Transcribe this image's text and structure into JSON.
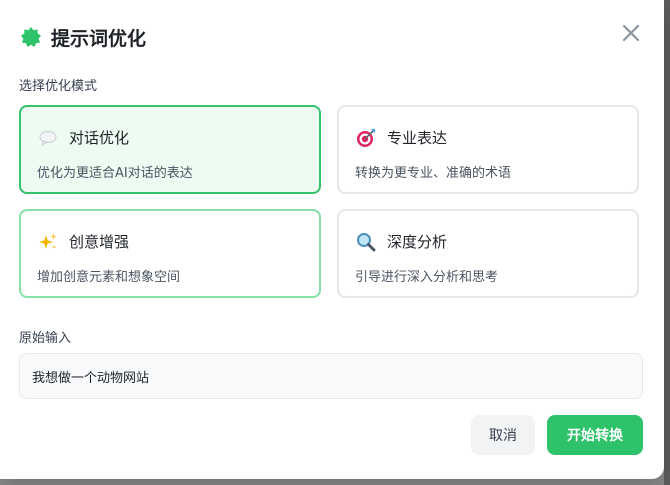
{
  "dialog": {
    "title": "提示词优化",
    "close_icon": "close-icon",
    "logo_icon": "gear-badge-icon",
    "accent_color": "#2ec36a"
  },
  "mode_section": {
    "label": "选择优化模式",
    "options": [
      {
        "icon": "speech-bubble-icon",
        "title": "对话优化",
        "description": "优化为更适合AI对话的表达",
        "state": "selected"
      },
      {
        "icon": "target-icon",
        "title": "专业表达",
        "description": "转换为更专业、准确的术语",
        "state": "default"
      },
      {
        "icon": "sparkles-icon",
        "title": "创意增强",
        "description": "增加创意元素和想象空间",
        "state": "hover"
      },
      {
        "icon": "magnifier-icon",
        "title": "深度分析",
        "description": "引导进行深入分析和思考",
        "state": "default"
      }
    ]
  },
  "input_section": {
    "label": "原始输入",
    "value": "我想做一个动物网站"
  },
  "footer": {
    "cancel_label": "取消",
    "start_label": "开始转换"
  }
}
